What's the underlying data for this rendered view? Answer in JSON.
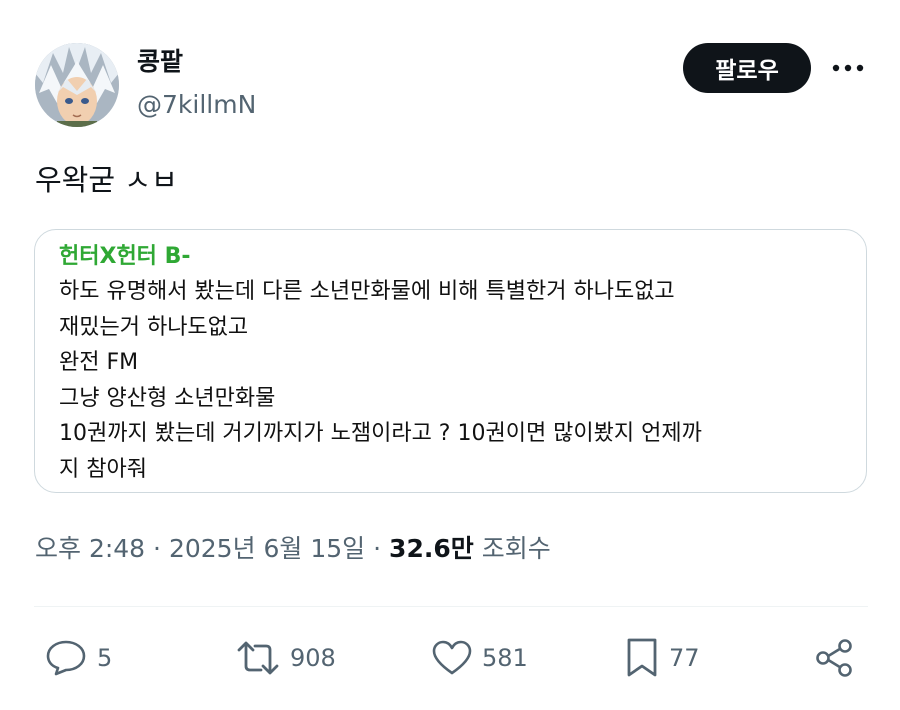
{
  "author": {
    "display_name": "콩팥",
    "handle": "@7killmN",
    "avatar_icon": "anime-character-avatar"
  },
  "follow_label": "팔로우",
  "tweet": {
    "text": "우왁굳 ㅅㅂ"
  },
  "card": {
    "title": "헌터X헌터 B-",
    "lines": [
      "하도 유명해서 봤는데 다른 소년만화물에 비해 특별한거 하나도없고",
      "재밌는거 하나도없고",
      "완전 FM",
      "그냥 양산형 소년만화물",
      "10권까지 봤는데 거기까지가 노잼이라고 ? 10권이면 많이봤지 언제까",
      "지 참아줘"
    ]
  },
  "meta": {
    "time": "오후 2:48",
    "separator": "·",
    "date": "2025년 6월 15일",
    "views_count": "32.6만",
    "views_label": "조회수"
  },
  "actions": {
    "replies": "5",
    "retweets": "908",
    "likes": "581",
    "bookmarks": "77"
  },
  "colors": {
    "card_title": "#2fa834",
    "secondary_text": "#536471",
    "follow_button": "#0f1419"
  }
}
